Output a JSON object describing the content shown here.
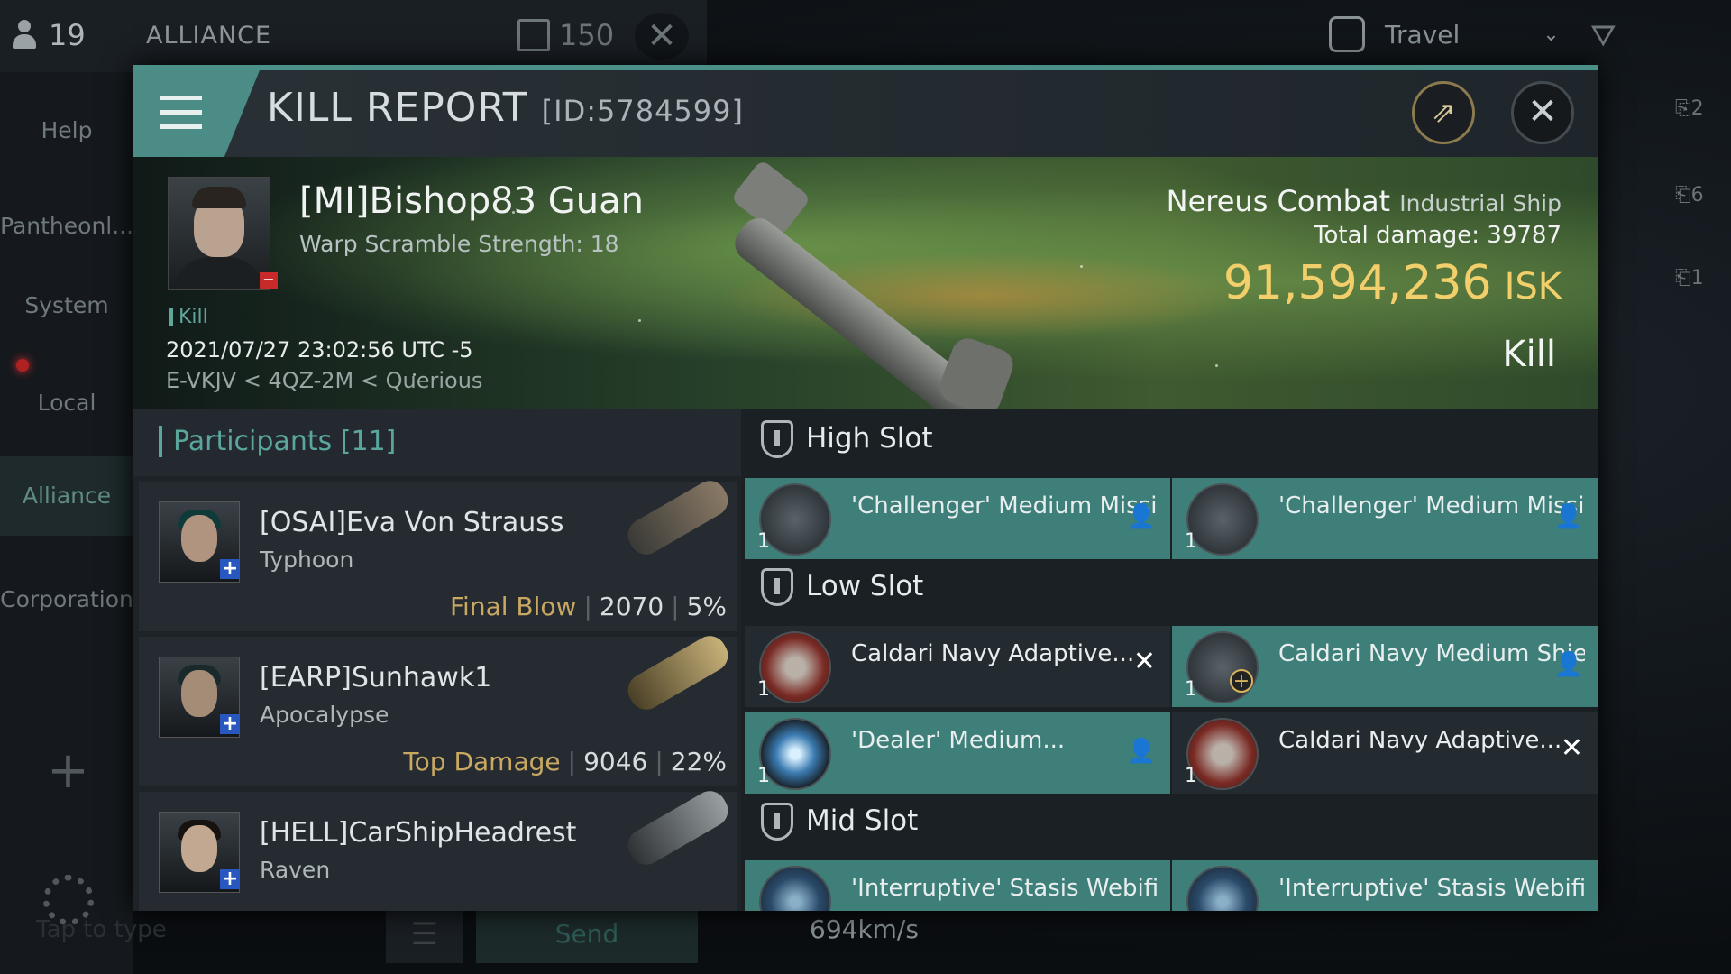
{
  "chat": {
    "member_count": "19",
    "channel_title": "ALLIANCE",
    "channel_count": "150",
    "nav": [
      "Help",
      "Pantheonl...",
      "System",
      "Local",
      "Alliance",
      "Corporation"
    ],
    "input_placeholder": "Tap to type",
    "send_label": "Send"
  },
  "topbar": {
    "travel_label": "Travel"
  },
  "side_icons": [
    "2",
    "6",
    "1"
  ],
  "hud": {
    "speed": "694km/s"
  },
  "report": {
    "title": "KILL REPORT",
    "id": "[ID:5784599]",
    "victim": {
      "name": "[MI]Bishop83 Guan",
      "warp_scramble": "Warp Scramble Strength: 18",
      "kill_tag": "Kill",
      "datetime": "2021/07/27 23:02:56 UTC -5",
      "location": "E-VKJV < 4QZ-2M < Querious"
    },
    "ship": {
      "name": "Nereus Combat",
      "type": "Industrial Ship",
      "total_damage_label": "Total damage:",
      "total_damage": "39787",
      "isk_value": "91,594,236",
      "isk_unit": "ISK",
      "result": "Kill"
    },
    "participants": {
      "label": "Participants",
      "count": "[11]",
      "rows": [
        {
          "name": "[OSAI]Eva Von Strauss",
          "ship": "Typhoon",
          "role": "Final Blow",
          "damage": "2070",
          "percent": "5%"
        },
        {
          "name": "[EARP]Sunhawk1",
          "ship": "Apocalypse",
          "role": "Top Damage",
          "damage": "9046",
          "percent": "22%"
        },
        {
          "name": "[HELL]CarShipHeadrest",
          "ship": "Raven",
          "role": "",
          "damage": "",
          "percent": ""
        }
      ]
    },
    "slots": {
      "high": {
        "label": "High Slot",
        "modules": [
          {
            "name": "'Challenger' Medium Missile ...",
            "qty": "1",
            "icon": "missile-launcher-icon",
            "status": "dropped"
          },
          {
            "name": "'Challenger' Medium Missile ...",
            "qty": "1",
            "icon": "missile-launcher-icon",
            "status": "dropped"
          }
        ]
      },
      "low": {
        "label": "Low Slot",
        "modules": [
          {
            "name": "Caldari Navy Adaptive...",
            "qty": "1",
            "icon": "shield-hardener-icon",
            "status": "destroyed"
          },
          {
            "name": "Caldari Navy Medium Shield ...",
            "qty": "1",
            "icon": "shield-extender-icon",
            "status": "dropped"
          },
          {
            "name": "'Dealer' Medium...",
            "qty": "1",
            "icon": "afterburner-icon",
            "status": "dropped"
          },
          {
            "name": "Caldari Navy Adaptive...",
            "qty": "1",
            "icon": "shield-hardener-icon",
            "status": "destroyed"
          }
        ]
      },
      "mid": {
        "label": "Mid Slot",
        "modules": [
          {
            "name": "'Interruptive' Stasis Webifier",
            "icon": "stasis-webifier-icon"
          },
          {
            "name": "'Interruptive' Stasis Webifier",
            "icon": "stasis-webifier-icon"
          }
        ]
      }
    },
    "colors": {
      "accent": "#4b8c86",
      "isk": "#f2cf6a",
      "role": "#c9a962"
    }
  }
}
